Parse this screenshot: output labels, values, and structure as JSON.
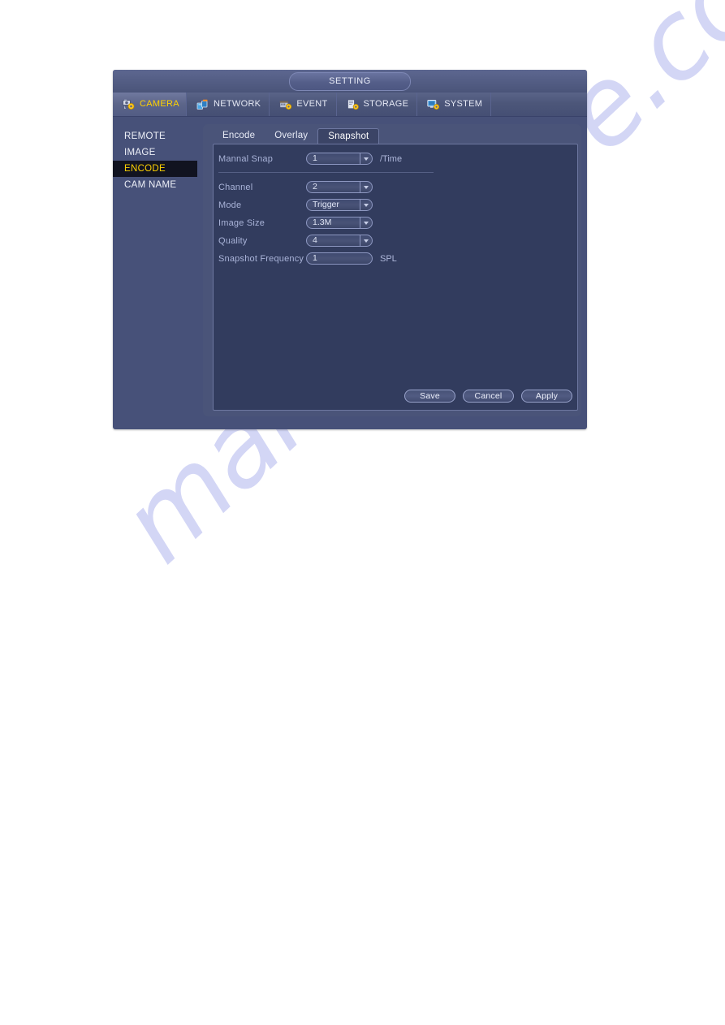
{
  "window": {
    "title": "SETTING"
  },
  "nav": {
    "items": [
      {
        "label": "CAMERA",
        "icon": "camera-gear-icon",
        "active": true
      },
      {
        "label": "NETWORK",
        "icon": "network-icon",
        "active": false
      },
      {
        "label": "EVENT",
        "icon": "event-gear-icon",
        "active": false
      },
      {
        "label": "STORAGE",
        "icon": "storage-gear-icon",
        "active": false
      },
      {
        "label": "SYSTEM",
        "icon": "system-gear-icon",
        "active": false
      }
    ]
  },
  "sidebar": {
    "items": [
      {
        "label": "REMOTE",
        "active": false
      },
      {
        "label": "IMAGE",
        "active": false
      },
      {
        "label": "ENCODE",
        "active": true
      },
      {
        "label": "CAM NAME",
        "active": false
      }
    ]
  },
  "tabs": [
    {
      "label": "Encode",
      "active": false
    },
    {
      "label": "Overlay",
      "active": false
    },
    {
      "label": "Snapshot",
      "active": true
    }
  ],
  "form": {
    "manual_snap": {
      "label": "Mannal Snap",
      "value": "1",
      "suffix": "/Time"
    },
    "channel": {
      "label": "Channel",
      "value": "2"
    },
    "mode": {
      "label": "Mode",
      "value": "Trigger"
    },
    "image_size": {
      "label": "Image Size",
      "value": "1.3M"
    },
    "quality": {
      "label": "Quality",
      "value": "4"
    },
    "snapshot_frequency": {
      "label": "Snapshot Frequency",
      "value": "1",
      "suffix": "SPL"
    }
  },
  "buttons": {
    "save": "Save",
    "cancel": "Cancel",
    "apply": "Apply"
  },
  "watermark": {
    "text": "manualshive.com"
  },
  "colors": {
    "window_bg": "#475179",
    "panel_bg": "#323c5e",
    "card_bg": "#4a5479",
    "accent_yellow": "#ffd200",
    "label_blue": "#a9b3d8",
    "border_light": "#8e98c2",
    "watermark": "#b9bdf0"
  }
}
